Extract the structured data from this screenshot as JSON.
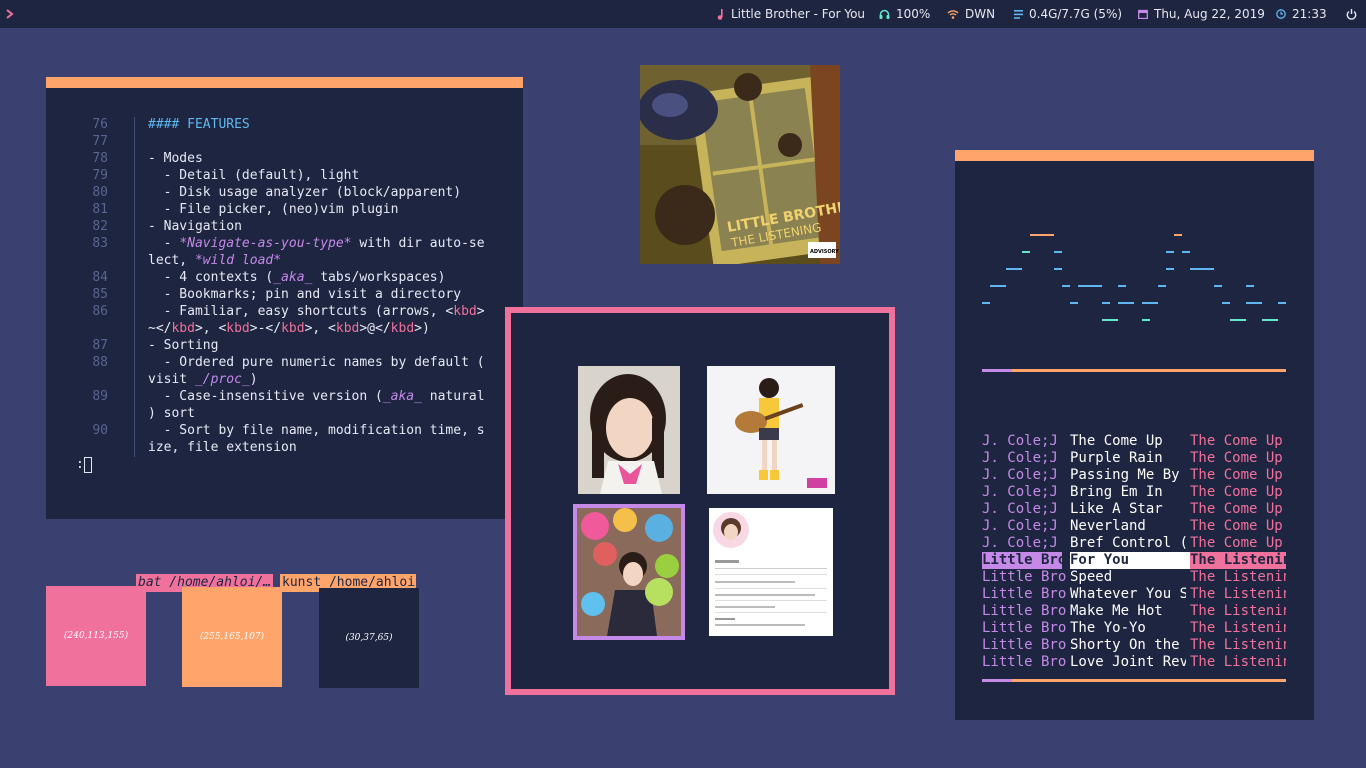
{
  "topbar": {
    "launcher_icon": "chevron-right-icon",
    "now_playing": "Little Brother - For You",
    "volume": "100%",
    "network": "DWN",
    "memory": "0.4G/7.7G (5%)",
    "date": "Thu, Aug 22, 2019",
    "time": "21:33",
    "colors": {
      "music": "#f0719b",
      "volume": "#60e8c8",
      "network": "#ffa56b",
      "memory": "#60b8f0",
      "date": "#c58ae8",
      "time": "#60b8f0"
    }
  },
  "editor": {
    "lines": [
      {
        "n": "76",
        "t": "#### FEATURES"
      },
      {
        "n": "77",
        "t": ""
      },
      {
        "n": "78",
        "t": "- Modes"
      },
      {
        "n": "79",
        "t": "  - Detail (default), light"
      },
      {
        "n": "80",
        "t": "  - Disk usage analyzer (block/apparent)"
      },
      {
        "n": "81",
        "t": "  - File picker, (neo)vim plugin"
      },
      {
        "n": "82",
        "t": "- Navigation"
      },
      {
        "n": "83",
        "t": "  - *Navigate-as-you-type* with dir auto-se"
      },
      {
        "n": "",
        "t": "lect, *wild load*"
      },
      {
        "n": "84",
        "t": "  - 4 contexts (_aka_ tabs/workspaces)"
      },
      {
        "n": "85",
        "t": "  - Bookmarks; pin and visit a directory"
      },
      {
        "n": "86",
        "t": "  - Familiar, easy shortcuts (arrows, <kbd>"
      },
      {
        "n": "",
        "t": "~</kbd>, <kbd>-</kbd>, <kbd>@</kbd>)"
      },
      {
        "n": "87",
        "t": "- Sorting"
      },
      {
        "n": "88",
        "t": "  - Ordered pure numeric names by default ("
      },
      {
        "n": "",
        "t": "visit _/proc_)"
      },
      {
        "n": "89",
        "t": "  - Case-insensitive version (_aka_ natural"
      },
      {
        "n": "",
        "t": ") sort"
      },
      {
        "n": "90",
        "t": "  - Sort by file name, modification time, s"
      },
      {
        "n": "",
        "t": "ize, file extension"
      }
    ],
    "prompt": ":",
    "tab_1": "bat /home/ahloi/…",
    "tab_2": "kunst /home/ahloi"
  },
  "swatches": [
    {
      "label": "(240,113,155)",
      "color": "#f0719b"
    },
    {
      "label": "(255,165,107)",
      "color": "#ffa56b"
    },
    {
      "label": "(30,37,65)",
      "color": "#1e2541"
    }
  ],
  "album": {
    "title": "LITTLE BROTHER",
    "subtitle": "THE LISTENING",
    "sticker": "ADVISORY"
  },
  "viewer": {
    "selected_index": 2
  },
  "playlist": {
    "progress": 0.1,
    "rows": [
      {
        "artist": "J. Cole;J",
        "title": "The Come Up",
        "album": "The Come Up"
      },
      {
        "artist": "J. Cole;J",
        "title": "Purple Rain",
        "album": "The Come Up"
      },
      {
        "artist": "J. Cole;J",
        "title": "Passing Me By",
        "album": "The Come Up"
      },
      {
        "artist": "J. Cole;J",
        "title": "Bring Em In",
        "album": "The Come Up"
      },
      {
        "artist": "J. Cole;J",
        "title": "Like A Star",
        "album": "The Come Up"
      },
      {
        "artist": "J. Cole;J",
        "title": "Neverland",
        "album": "The Come Up"
      },
      {
        "artist": "J. Cole;J",
        "title": "Bref Control (",
        "album": "The Come Up"
      },
      {
        "artist": "Little Bro",
        "title": "For You",
        "album": "The Listenin",
        "current": true
      },
      {
        "artist": "Little Bro",
        "title": "Speed",
        "album": "The Listenin"
      },
      {
        "artist": "Little Bro",
        "title": "Whatever You S",
        "album": "The Listenin"
      },
      {
        "artist": "Little Bro",
        "title": "Make Me Hot",
        "album": "The Listenin"
      },
      {
        "artist": "Little Bro",
        "title": "The Yo-Yo",
        "album": "The Listenin"
      },
      {
        "artist": "Little Bro",
        "title": "Shorty On the",
        "album": "The Listenin"
      },
      {
        "artist": "Little Bro",
        "title": "Love Joint Rev",
        "album": "The Listenin"
      }
    ]
  }
}
